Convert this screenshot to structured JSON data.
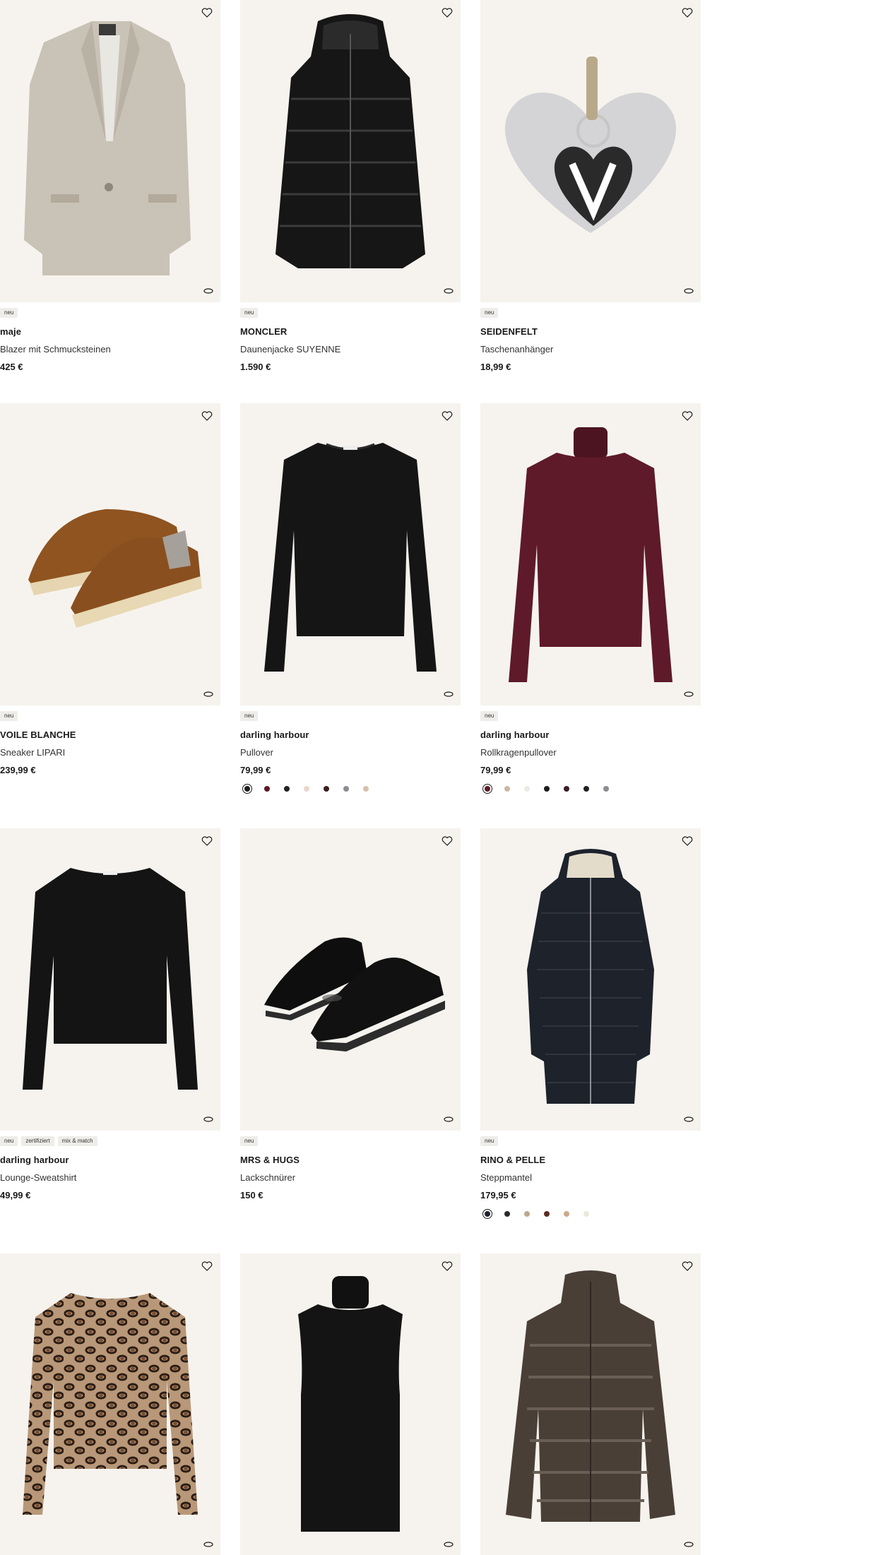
{
  "products": [
    {
      "brand": "maje",
      "name": "Blazer mit Schmucksteinen",
      "price": "425 €",
      "badges": [
        "neu"
      ],
      "swatches": []
    },
    {
      "brand": "MONCLER",
      "name": "Daunenjacke SUYENNE",
      "price": "1.590 €",
      "badges": [
        "neu"
      ],
      "swatches": []
    },
    {
      "brand": "SEIDENFELT",
      "name": "Taschenanhänger",
      "price": "18,99 €",
      "badges": [
        "neu"
      ],
      "swatches": []
    },
    {
      "brand": "VOILE BLANCHE",
      "name": "Sneaker LIPARI",
      "price": "239,99 €",
      "badges": [
        "neu"
      ],
      "swatches": []
    },
    {
      "brand": "darling harbour",
      "name": "Pullover",
      "price": "79,99 €",
      "badges": [
        "neu"
      ],
      "swatches": [
        "#1d1d1d",
        "#5a1a24",
        "#222222",
        "#e6d8cc",
        "#3a1f1f",
        "#8a8c90",
        "#d6c0ac"
      ],
      "selected_swatch": 0
    },
    {
      "brand": "darling harbour",
      "name": "Rollkragenpullover",
      "price": "79,99 €",
      "badges": [
        "neu"
      ],
      "swatches": [
        "#5c1a28",
        "#cbb8a8",
        "#ecebe3",
        "#1c1c1c",
        "#3a1f25",
        "#1f1f1f",
        "#8a8c90"
      ],
      "selected_swatch": 0
    },
    {
      "brand": "darling harbour",
      "name": "Lounge-Sweatshirt",
      "price": "49,99 €",
      "badges": [
        "neu",
        "zertifiziert",
        "mix & match"
      ],
      "swatches": []
    },
    {
      "brand": "MRS & HUGS",
      "name": "Lackschnürer",
      "price": "150 €",
      "badges": [
        "neu"
      ],
      "swatches": []
    },
    {
      "brand": "RINO & PELLE",
      "name": "Steppmantel",
      "price": "179,95 €",
      "badges": [
        "neu"
      ],
      "swatches": [
        "#1e232b",
        "#2a2a2a",
        "#bca88e",
        "#5a2e22",
        "#c8ab8a",
        "#ece8dc"
      ],
      "selected_swatch": 0
    },
    {
      "brand": "",
      "name": "",
      "price": "",
      "badges": [],
      "swatches": []
    },
    {
      "brand": "",
      "name": "",
      "price": "",
      "badges": [],
      "swatches": []
    },
    {
      "brand": "",
      "name": "",
      "price": "",
      "badges": [],
      "swatches": []
    }
  ],
  "icons": {
    "wishlist": "heart-outline-icon",
    "view": "360-view-icon"
  },
  "colors": {
    "image_bg": "#f6f3ee",
    "badge_bg": "#efede9",
    "text": "#1a1a1a"
  }
}
